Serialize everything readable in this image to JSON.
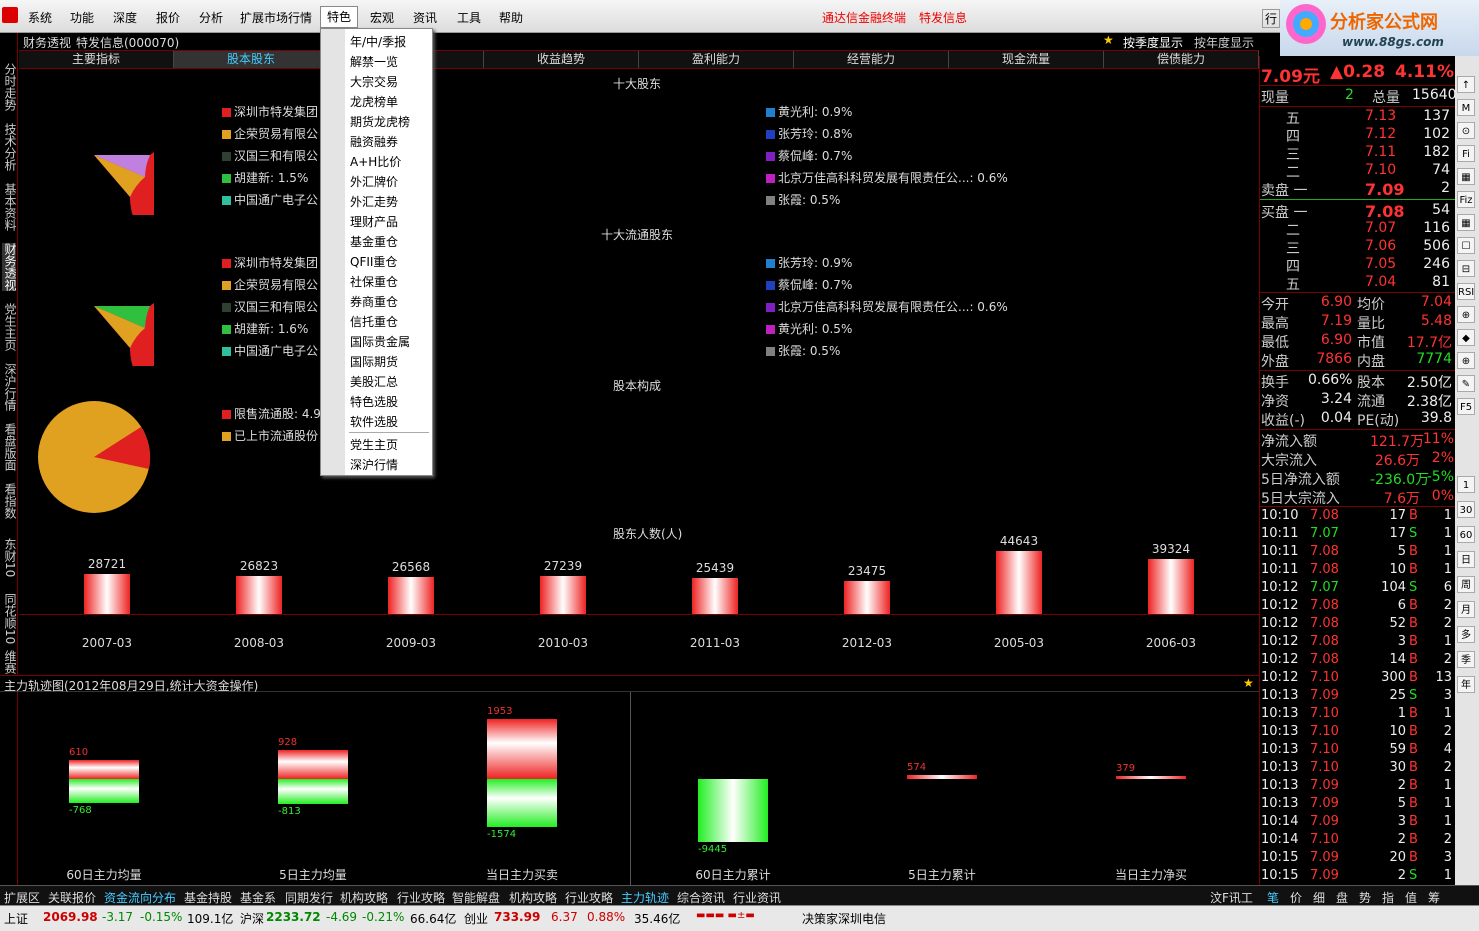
{
  "menu": {
    "items": [
      "系统",
      "功能",
      "深度",
      "报价",
      "分析",
      "扩展市场行情",
      "特色",
      "宏观",
      "资讯",
      "工具",
      "帮助"
    ],
    "links": [
      "通达信金融终端",
      "特发信息"
    ],
    "window_btn": "行"
  },
  "brand": {
    "title": "分析家公式网",
    "url": "www.88gs.com"
  },
  "left_tabs": [
    "分时走势",
    "技术分析",
    "基本资料",
    "财务透视",
    "党生主页",
    "深沪行情",
    "看盘版面",
    "看指数",
    "东财10",
    "同花顺10",
    "维赛"
  ],
  "title": {
    "left": "财务透视",
    "code": "特发信息(000070)",
    "btn1": "按季度显示",
    "btn2": "按年度显示"
  },
  "tabs": [
    "主要指标",
    "股本股东",
    "",
    "收益趋势",
    "盈利能力",
    "经营能力",
    "现金流量",
    "偿债能力"
  ],
  "sections": {
    "top10": "十大股东",
    "top10float": "十大流通股东",
    "structure": "股本构成",
    "holders": "股东人数(人)"
  },
  "top10_left": [
    {
      "name": "深圳市特发集团",
      "color": "#e02020"
    },
    {
      "name": "企荣贸易有限公",
      "color": "#e0a020"
    },
    {
      "name": "汉国三和有限公",
      "color": "#304030"
    },
    {
      "name": "胡建新: 1.5%",
      "color": "#30c040"
    },
    {
      "name": "中国通广电子公",
      "color": "#30c0a0"
    }
  ],
  "top10_right": [
    {
      "name": "黄光利: 0.9%",
      "color": "#2080d0"
    },
    {
      "name": "张芳玲: 0.8%",
      "color": "#2040c0"
    },
    {
      "name": "蔡侃峰: 0.7%",
      "color": "#8020c0"
    },
    {
      "name": "北京万佳高科科贸发展有限责任公...: 0.6%",
      "color": "#c020c0"
    },
    {
      "name": "张霞: 0.5%",
      "color": "#808080"
    }
  ],
  "float_left": [
    {
      "name": "深圳市特发集团",
      "color": "#e02020"
    },
    {
      "name": "企荣贸易有限公",
      "color": "#e0a020"
    },
    {
      "name": "汉国三和有限公",
      "color": "#304030"
    },
    {
      "name": "胡建新: 1.6%",
      "color": "#30c040"
    },
    {
      "name": "中国通广电子公",
      "color": "#30c0a0"
    }
  ],
  "float_right": [
    {
      "name": "张芳玲: 0.9%",
      "color": "#2080d0"
    },
    {
      "name": "蔡侃峰: 0.7%",
      "color": "#2040c0"
    },
    {
      "name": "北京万佳高科科贸发展有限责任公...: 0.6%",
      "color": "#8020c0"
    },
    {
      "name": "黄光利: 0.5%",
      "color": "#c020c0"
    },
    {
      "name": "张霞: 0.5%",
      "color": "#808080"
    }
  ],
  "structure_legend": [
    {
      "name": "限售流通股: 4.9",
      "color": "#e02020"
    },
    {
      "name": "已上市流通股份",
      "color": "#e0a020"
    }
  ],
  "dropdown": [
    "年/中/季报",
    "解禁一览",
    "大宗交易",
    "龙虎榜单",
    "期货龙虎榜",
    "融资融券",
    "A+H比价",
    "外汇牌价",
    "外汇走势",
    "理财产品",
    "基金重仓",
    "QFII重仓",
    "社保重仓",
    "券商重仓",
    "信托重仓",
    "国际贵金属",
    "国际期货",
    "美股汇总",
    "特色选股",
    "软件选股",
    "党生主页",
    "深沪行情"
  ],
  "chart_data": [
    {
      "type": "bar",
      "title": "股东人数(人)",
      "categories": [
        "2007-03",
        "2008-03",
        "2009-03",
        "2010-03",
        "2011-03",
        "2012-03",
        "2005-03",
        "2006-03"
      ],
      "values": [
        28721,
        26823,
        26568,
        27239,
        25439,
        23475,
        44643,
        39324
      ]
    },
    {
      "type": "bar",
      "title": "主力轨迹图",
      "categories": [
        "60日主力均量",
        "5日主力均量",
        "当日主力买卖"
      ],
      "series": [
        {
          "values": [
            610,
            928,
            1953
          ]
        },
        {
          "values": [
            -768,
            -813,
            -1574
          ]
        }
      ]
    },
    {
      "type": "bar",
      "categories": [
        "60日主力累计",
        "5日主力累计",
        "当日主力净买"
      ],
      "values": [
        -9445,
        574,
        379
      ]
    }
  ],
  "flow": {
    "title": "主力轨迹图(2012年08月29日,统计大资金操作)"
  },
  "bottom_tabs": [
    "扩展区",
    "关联报价",
    "资金流向分布",
    "基金持股",
    "基金系",
    "同期发行",
    "机构攻略",
    "行业攻略",
    "智能解盘",
    "机构攻略",
    "行业攻略",
    "主力轨迹",
    "综合资讯",
    "行业资讯"
  ],
  "bottom_right_tabs": [
    "汶F讯工",
    "笔",
    "价",
    "细",
    "盘",
    "势",
    "指",
    "值",
    "筹"
  ],
  "status": {
    "sh": "上证",
    "sh_v": "2069.98",
    "sh_c": "-3.17",
    "sh_p": "-0.15%",
    "sh_a": "109.1亿",
    "sz": "沪深",
    "sz_v": "2233.72",
    "sz_c": "-4.69",
    "sz_p": "-0.21%",
    "sz_a": "66.64亿",
    "cy": "创业",
    "cy_v": "733.99",
    "cy_c": "6.37",
    "cy_p": "0.88%",
    "cy_a": "35.46亿",
    "msg": "决策家深圳电信"
  },
  "quote": {
    "price": "7.09元",
    "chg": "▲0.28",
    "pct": "4.11%",
    "xl": "现量",
    "xl_v": "2",
    "zl": "总量",
    "zl_v": "15640",
    "asks": [
      {
        "lv": "五",
        "p": "7.13",
        "v": "137"
      },
      {
        "lv": "四",
        "p": "7.12",
        "v": "102"
      },
      {
        "lv": "三",
        "p": "7.11",
        "v": "182"
      },
      {
        "lv": "二",
        "p": "7.10",
        "v": "74"
      },
      {
        "lv": "卖盘 一",
        "p": "7.09",
        "v": "2"
      }
    ],
    "bids": [
      {
        "lv": "买盘 一",
        "p": "7.08",
        "v": "54"
      },
      {
        "lv": "二",
        "p": "7.07",
        "v": "116"
      },
      {
        "lv": "三",
        "p": "7.06",
        "v": "506"
      },
      {
        "lv": "四",
        "p": "7.05",
        "v": "246"
      },
      {
        "lv": "五",
        "p": "7.04",
        "v": "81"
      }
    ],
    "stats": [
      [
        "今开",
        "6.90",
        "均价",
        "7.04"
      ],
      [
        "最高",
        "7.19",
        "量比",
        "5.48"
      ],
      [
        "最低",
        "6.90",
        "市值",
        "17.7亿"
      ],
      [
        "外盘",
        "7866",
        "内盘",
        "7774"
      ]
    ],
    "stats2": [
      [
        "换手",
        "0.66%",
        "股本",
        "2.50亿"
      ],
      [
        "净资",
        "3.24",
        "流通",
        "2.38亿"
      ],
      [
        "收益(-)",
        "0.04",
        "PE(动)",
        "39.8"
      ]
    ],
    "flows": [
      [
        "净流入额",
        "121.7万",
        "11%"
      ],
      [
        "大宗流入",
        "26.6万",
        "2%"
      ],
      [
        "5日净流入额",
        "-236.0万",
        "-5%"
      ],
      [
        "5日大宗流入",
        "7.6万",
        "0%"
      ]
    ],
    "ticks": [
      [
        "10:10",
        "7.08",
        "17",
        "B",
        "1"
      ],
      [
        "10:11",
        "7.07",
        "17",
        "S",
        "1"
      ],
      [
        "10:11",
        "7.08",
        "5",
        "B",
        "1"
      ],
      [
        "10:11",
        "7.08",
        "10",
        "B",
        "1"
      ],
      [
        "10:12",
        "7.07",
        "104",
        "S",
        "6"
      ],
      [
        "10:12",
        "7.08",
        "6",
        "B",
        "2"
      ],
      [
        "10:12",
        "7.08",
        "52",
        "B",
        "2"
      ],
      [
        "10:12",
        "7.08",
        "3",
        "B",
        "1"
      ],
      [
        "10:12",
        "7.08",
        "14",
        "B",
        "2"
      ],
      [
        "10:12",
        "7.10",
        "300",
        "B",
        "13"
      ],
      [
        "10:13",
        "7.09",
        "25",
        "S",
        "3"
      ],
      [
        "10:13",
        "7.10",
        "1",
        "B",
        "1"
      ],
      [
        "10:13",
        "7.10",
        "10",
        "B",
        "2"
      ],
      [
        "10:13",
        "7.10",
        "59",
        "B",
        "4"
      ],
      [
        "10:13",
        "7.10",
        "30",
        "B",
        "2"
      ],
      [
        "10:13",
        "7.09",
        "2",
        "B",
        "1"
      ],
      [
        "10:13",
        "7.09",
        "5",
        "B",
        "1"
      ],
      [
        "10:14",
        "7.09",
        "3",
        "B",
        "1"
      ],
      [
        "10:14",
        "7.10",
        "2",
        "B",
        "2"
      ],
      [
        "10:15",
        "7.09",
        "20",
        "B",
        "3"
      ],
      [
        "10:15",
        "7.09",
        "2",
        "S",
        "1"
      ]
    ]
  },
  "right_icons": [
    "↑",
    "M",
    "⊙",
    "Fi",
    "▦",
    "Fiz",
    "▦",
    "☐",
    "⊟",
    "RSI",
    "⊕",
    "◆",
    "⊕",
    "✎",
    "F5",
    "1",
    "30",
    "60",
    "日",
    "周",
    "月",
    "多",
    "季",
    "年"
  ]
}
